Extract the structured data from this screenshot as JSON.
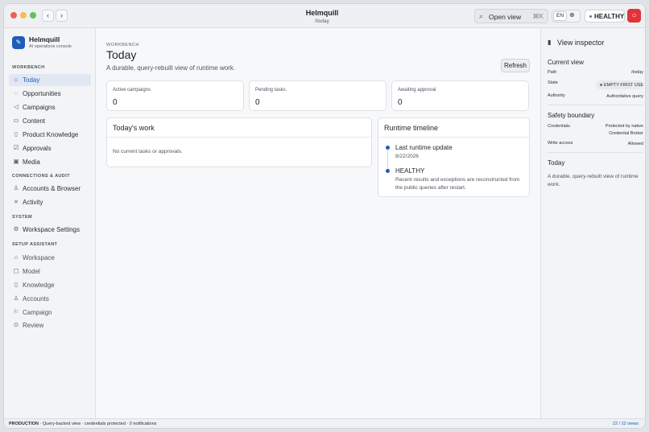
{
  "window": {
    "title": "Helmquill",
    "path": "/today",
    "open_view_label": "Open view",
    "open_view_shortcut": "⌘K",
    "lang": "EN",
    "health_label": "HEALTHY"
  },
  "brand": {
    "name": "Helmquill",
    "subtitle": "AI operations console"
  },
  "sidebar": {
    "sections": [
      {
        "label": "WORKBENCH"
      },
      {
        "label": "CONNECTIONS & AUDIT"
      },
      {
        "label": "SYSTEM"
      },
      {
        "label": "SETUP ASSISTANT"
      }
    ],
    "items": [
      {
        "label": "Today",
        "icon": "sun-icon",
        "active": true
      },
      {
        "label": "Opportunities",
        "icon": "lightbulb-icon"
      },
      {
        "label": "Campaigns",
        "icon": "megaphone-icon"
      },
      {
        "label": "Content",
        "icon": "document-icon"
      },
      {
        "label": "Product Knowledge",
        "icon": "book-icon"
      },
      {
        "label": "Approvals",
        "icon": "checklist-icon"
      },
      {
        "label": "Media",
        "icon": "image-icon"
      },
      {
        "label": "Accounts & Browser",
        "icon": "users-icon"
      },
      {
        "label": "Activity",
        "icon": "activity-icon"
      },
      {
        "label": "Workspace Settings",
        "icon": "gear-icon"
      },
      {
        "label": "Workspace",
        "icon": "home-icon"
      },
      {
        "label": "Model",
        "icon": "cube-icon"
      },
      {
        "label": "Knowledge",
        "icon": "book-icon"
      },
      {
        "label": "Accounts",
        "icon": "users-icon"
      },
      {
        "label": "Campaign",
        "icon": "flag-icon"
      },
      {
        "label": "Review",
        "icon": "check-circle-icon"
      }
    ]
  },
  "main": {
    "eyebrow": "WORKBENCH",
    "title": "Today",
    "subtitle": "A durable, query-rebuilt view of runtime work.",
    "refresh_label": "Refresh",
    "stats": [
      {
        "label": "Active campaigns",
        "value": "0"
      },
      {
        "label": "Pending tasks",
        "value": "0"
      },
      {
        "label": "Awaiting approval",
        "value": "0"
      }
    ],
    "todays_work": {
      "title": "Today's work",
      "empty_text": "No current tasks or approvals."
    },
    "timeline": {
      "title": "Runtime timeline",
      "events": [
        {
          "title": "Last runtime update",
          "detail": "8/22/2026"
        },
        {
          "title": "HEALTHY",
          "detail": "Recent results and exceptions are reconstructed from the public queries after restart."
        }
      ]
    }
  },
  "inspector": {
    "title": "View inspector",
    "current_view": {
      "heading": "Current view",
      "path_key": "Path",
      "path_value": "/today",
      "state_key": "State",
      "state_value": "EMPTY FIRST USE",
      "authority_key": "Authority",
      "authority_value": "Authoritative query"
    },
    "safety": {
      "heading": "Safety boundary",
      "credentials_key": "Credentials",
      "credentials_value_1": "Protected by native",
      "credentials_value_2": "Credential Broker",
      "write_key": "Write access",
      "write_value": "Allowed"
    },
    "today": {
      "heading": "Today",
      "description": "A durable, query-rebuilt view of runtime work."
    }
  },
  "statusbar": {
    "env": "PRODUCTION",
    "details": " · Query-backed view · credentials protected · 0 notifications",
    "views": "22 / 22 views"
  },
  "colors": {
    "accent": "#1d5fb8",
    "danger": "#e2333b",
    "active_bg": "#e1e8f4"
  }
}
